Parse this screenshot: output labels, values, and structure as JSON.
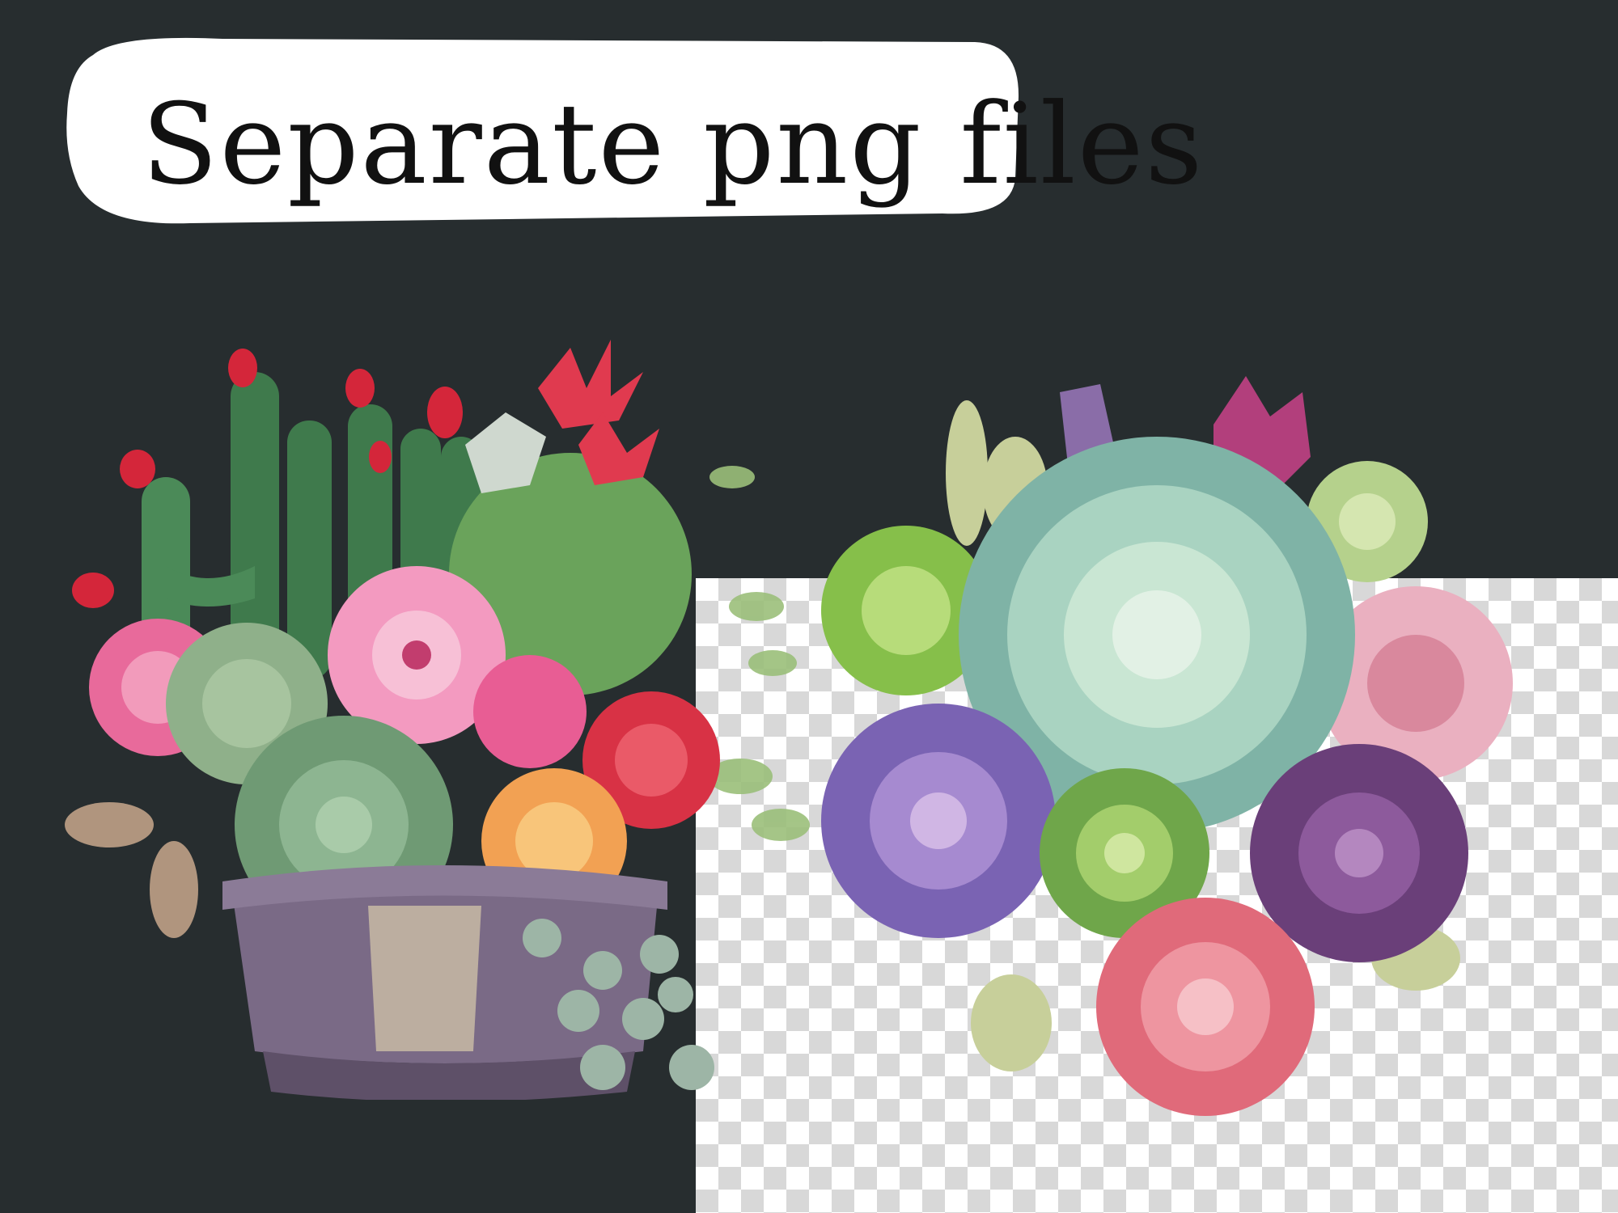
{
  "banner": {
    "text": "Separate png files"
  },
  "colors": {
    "background": "#272d2f",
    "banner": "#ffffff",
    "banner_text": "#111111",
    "checker_light": "#ffffff",
    "checker_dark": "#d8d8d8"
  },
  "illustrations": {
    "left": "potted cactus and succulent arrangement",
    "right": "succulent bouquet on transparent background"
  }
}
